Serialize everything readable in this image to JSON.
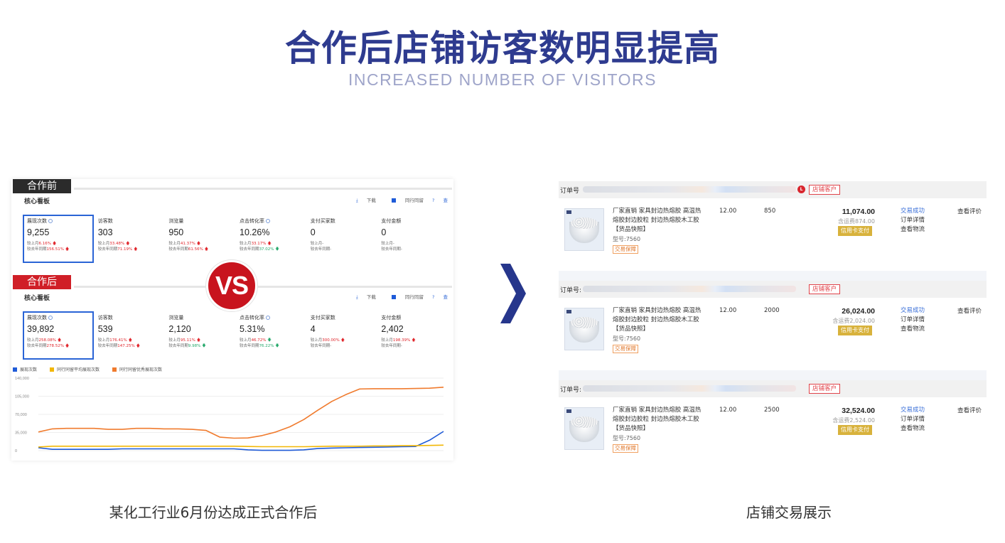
{
  "header": {
    "title": "合作后店铺访客数明显提高",
    "subtitle": "INCREASED NUMBER OF VISITORS"
  },
  "comparison": {
    "before_tag": "合作前",
    "after_tag": "合作后",
    "vs_label": "VS",
    "panel_title": "核心看板",
    "tools": {
      "download": "下载",
      "peer": "同行同留",
      "more": "查"
    },
    "before_metrics": [
      {
        "label": "展现次数",
        "value": "9,255",
        "sub1_pre": "较上月",
        "sub1_pct": "6.16%",
        "sub1_dir": "up",
        "sub2_pre": "较去年同期",
        "sub2_pct": "156.51%",
        "sub2_dir": "up",
        "active": true
      },
      {
        "label": "访客数",
        "value": "303",
        "sub1_pre": "较上月",
        "sub1_pct": "33.48%",
        "sub1_dir": "up",
        "sub2_pre": "较去年同期",
        "sub2_pct": "71.19%",
        "sub2_dir": "up"
      },
      {
        "label": "浏览量",
        "value": "950",
        "sub1_pre": "较上月",
        "sub1_pct": "41.37%",
        "sub1_dir": "up",
        "sub2_pre": "较去年同期",
        "sub2_pct": "61.56%",
        "sub2_dir": "up"
      },
      {
        "label": "点击转化率",
        "value": "10.26%",
        "sub1_pre": "较上月",
        "sub1_pct": "33.17%",
        "sub1_dir": "up",
        "sub2_pre": "较去年同期",
        "sub2_pct": "37.02%",
        "sub2_dir": "down"
      },
      {
        "label": "支付买家数",
        "value": "0",
        "sub1_pre": "较上月-",
        "sub1_pct": "",
        "sub1_dir": "",
        "sub2_pre": "较去年同期-",
        "sub2_pct": "",
        "sub2_dir": ""
      },
      {
        "label": "支付金额",
        "value": "0",
        "sub1_pre": "较上月-",
        "sub1_pct": "",
        "sub1_dir": "",
        "sub2_pre": "较去年同期-",
        "sub2_pct": "",
        "sub2_dir": ""
      }
    ],
    "after_metrics": [
      {
        "label": "展现次数",
        "value": "39,892",
        "sub1_pre": "较上月",
        "sub1_pct": "258.08%",
        "sub1_dir": "up",
        "sub2_pre": "较去年同期",
        "sub2_pct": "278.52%",
        "sub2_dir": "up",
        "active": true
      },
      {
        "label": "访客数",
        "value": "539",
        "sub1_pre": "较上月",
        "sub1_pct": "176.41%",
        "sub1_dir": "up",
        "sub2_pre": "较去年同期",
        "sub2_pct": "147.25%",
        "sub2_dir": "up"
      },
      {
        "label": "浏览量",
        "value": "2,120",
        "sub1_pre": "较上月",
        "sub1_pct": "95.11%",
        "sub1_dir": "up",
        "sub2_pre": "较去年同期",
        "sub2_pct": "9.98%",
        "sub2_dir": "down"
      },
      {
        "label": "点击转化率",
        "value": "5.31%",
        "sub1_pre": "较上月",
        "sub1_pct": "46.72%",
        "sub1_dir": "down",
        "sub2_pre": "较去年同期",
        "sub2_pct": "76.22%",
        "sub2_dir": "down"
      },
      {
        "label": "支付买家数",
        "value": "4",
        "sub1_pre": "较上月",
        "sub1_pct": "300.00%",
        "sub1_dir": "up",
        "sub2_pre": "较去年同期-",
        "sub2_pct": "",
        "sub2_dir": ""
      },
      {
        "label": "支付金额",
        "value": "2,402",
        "sub1_pre": "较上月",
        "sub1_pct": "198.39%",
        "sub1_dir": "up",
        "sub2_pre": "较去年同期-",
        "sub2_pct": "",
        "sub2_dir": ""
      }
    ],
    "colors": {
      "red": "#e0252b",
      "green": "#24a86a",
      "accent": "#2a64d6"
    }
  },
  "chart_data": {
    "type": "line",
    "ylim": [
      0,
      140000
    ],
    "yticks": [
      "140,000",
      "105,000",
      "70,000",
      "35,000",
      "0"
    ],
    "ytick_values": [
      140000,
      105000,
      70000,
      35000,
      0
    ],
    "x": [
      1,
      2,
      3,
      4,
      5,
      6,
      7,
      8,
      9,
      10,
      11,
      12,
      13,
      14,
      15,
      16,
      17,
      18,
      19,
      20,
      21,
      22,
      23,
      24,
      25,
      26,
      27,
      28,
      29,
      30
    ],
    "series": [
      {
        "name": "展现次数",
        "color": "#1f5bd8",
        "values": [
          5500,
          2500,
          2500,
          2500,
          2500,
          2500,
          3500,
          3500,
          3500,
          3500,
          3500,
          3500,
          3500,
          3500,
          3500,
          1500,
          500,
          500,
          500,
          1500,
          4000,
          5000,
          5500,
          6000,
          6500,
          7000,
          7500,
          8000,
          20000,
          37000
        ]
      },
      {
        "name": "同行同留平均展现次数",
        "color": "#f2b705",
        "values": [
          7000,
          8500,
          8500,
          8500,
          8500,
          8500,
          8500,
          8500,
          8500,
          8500,
          8500,
          8500,
          8500,
          8500,
          8500,
          8000,
          7500,
          7500,
          7500,
          7500,
          8000,
          8500,
          8500,
          8500,
          9000,
          9000,
          9500,
          9500,
          10000,
          10500
        ]
      },
      {
        "name": "同行同留优秀展现次数",
        "color": "#f07b2e",
        "values": [
          36000,
          42000,
          43000,
          43000,
          43000,
          41000,
          41000,
          43000,
          43000,
          42000,
          42000,
          41000,
          39000,
          26000,
          24000,
          24500,
          29000,
          36000,
          46000,
          60000,
          78000,
          95000,
          108000,
          119000,
          119500,
          119500,
          119500,
          120000,
          120500,
          122500
        ]
      }
    ]
  },
  "orders": {
    "order_label": "订单号",
    "order_label_colon": "订单号:",
    "customer_tag": "店铺客户",
    "lp_badge": "L",
    "product_title": "厂家直销 家具封边热熔胶 高温热熔胶封边胶粒 封边热熔胶木工胶 【货品快照】",
    "model": "型号:7560",
    "guarantee": "交易保障",
    "pay_label": "信用卡支付",
    "status_1": "交易成功",
    "status_2": "订单详情",
    "status_3": "查看物流",
    "review": "查看评价",
    "items": [
      {
        "price": "12.00",
        "qty": "850",
        "total": "11,074.00",
        "shipping": "含运费874.00"
      },
      {
        "price": "12.00",
        "qty": "2000",
        "total": "26,024.00",
        "shipping": "含运费2,024.00"
      },
      {
        "price": "12.00",
        "qty": "2500",
        "total": "32,524.00",
        "shipping": "含运费2,524.00"
      }
    ]
  },
  "captions": {
    "left": "某化工行业6月份达成正式合作后",
    "right": "店铺交易展示"
  }
}
